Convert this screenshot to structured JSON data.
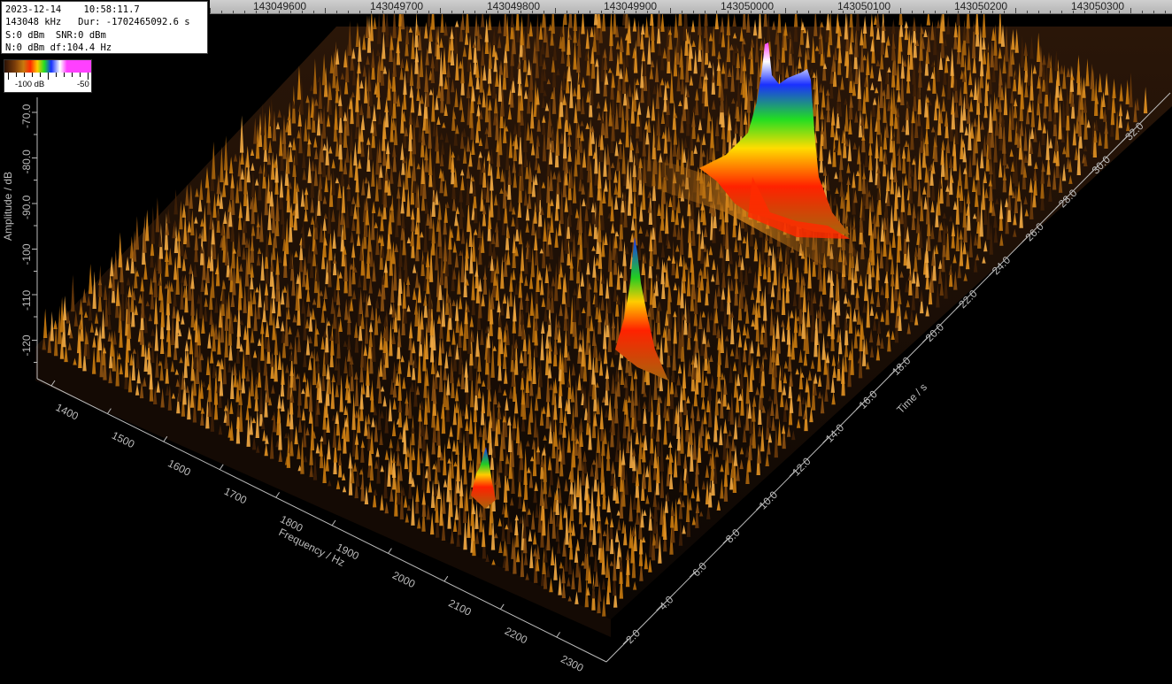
{
  "info": {
    "line1": "2023-12-14    10:58:11.7",
    "line2": "143048 kHz   Dur: -1702465092.6 s",
    "line3": "S:0 dBm  SNR:0 dBm",
    "line4": "N:0 dBm df:104.4 Hz"
  },
  "colorbar": {
    "min_label": "-100 dB",
    "max_label": "-50"
  },
  "ruler": {
    "labels": [
      "143049600",
      "143049700",
      "143049800",
      "143049900",
      "143050000",
      "143050100",
      "143050200",
      "143050300"
    ]
  },
  "axes": {
    "amplitude_title": "Amplitude / dB",
    "amplitude_ticks": [
      "-70.0",
      "-80.0",
      "-90.0",
      "-100",
      "-110",
      "-120"
    ],
    "frequency_title": "Frequency / Hz",
    "frequency_ticks": [
      "1400",
      "1500",
      "1600",
      "1700",
      "1800",
      "1900",
      "2000",
      "2100",
      "2200",
      "2300"
    ],
    "time_title": "Time / s",
    "time_ticks": [
      "2.0",
      "4.0",
      "6.0",
      "8.0",
      "10.0",
      "12.0",
      "14.0",
      "16.0",
      "18.0",
      "20.0",
      "22.0",
      "24.0",
      "26.0",
      "28.0",
      "30.0",
      "32.0"
    ]
  },
  "colors": {
    "background": "#000000",
    "noise": "#c8790e",
    "axis": "#bbbbbb"
  }
}
